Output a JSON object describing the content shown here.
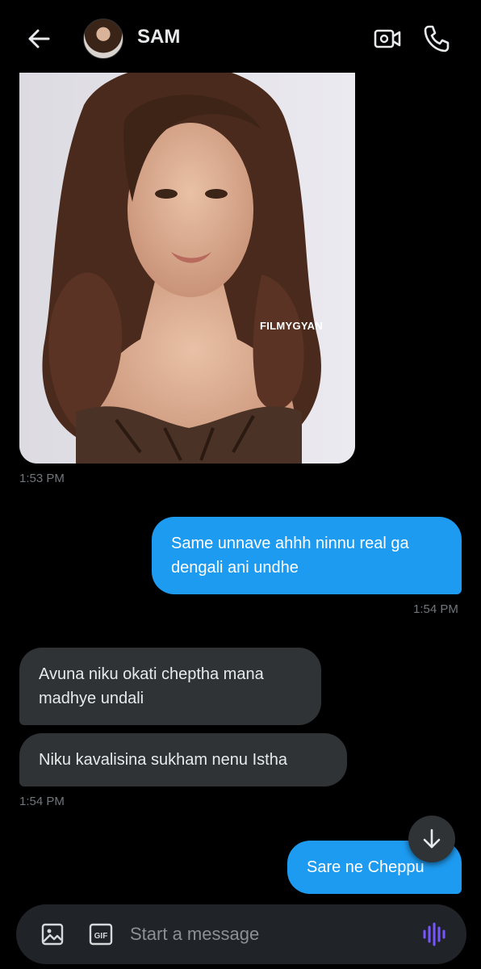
{
  "header": {
    "contact_name": "SAM",
    "back_icon": "arrow-left-icon",
    "video_icon": "video-call-icon",
    "call_icon": "phone-icon"
  },
  "messages": [
    {
      "type": "image",
      "direction": "incoming",
      "image_caption": "FILMYGYAN",
      "time": "1:53 PM"
    },
    {
      "type": "text",
      "direction": "outgoing",
      "lines": [
        "Same unnave ahhh ninnu real ga",
        "dengali ani undhe"
      ],
      "time": "1:54 PM"
    },
    {
      "type": "text",
      "direction": "incoming",
      "lines": [
        "Avuna niku okati cheptha mana",
        "madhye undali"
      ]
    },
    {
      "type": "text",
      "direction": "incoming",
      "lines": [
        "Niku kavalisina sukham nenu Istha"
      ],
      "time": "1:54 PM"
    },
    {
      "type": "text",
      "direction": "outgoing",
      "lines": [
        "Sare ne Cheppu"
      ]
    }
  ],
  "composer": {
    "placeholder": "Start a message",
    "gif_label": "GIF"
  },
  "colors": {
    "background": "#000000",
    "outgoing_bubble": "#1d9bf0",
    "incoming_bubble": "#2f3336",
    "timestamp": "#71767b",
    "voice_accent": "#7856ff"
  }
}
